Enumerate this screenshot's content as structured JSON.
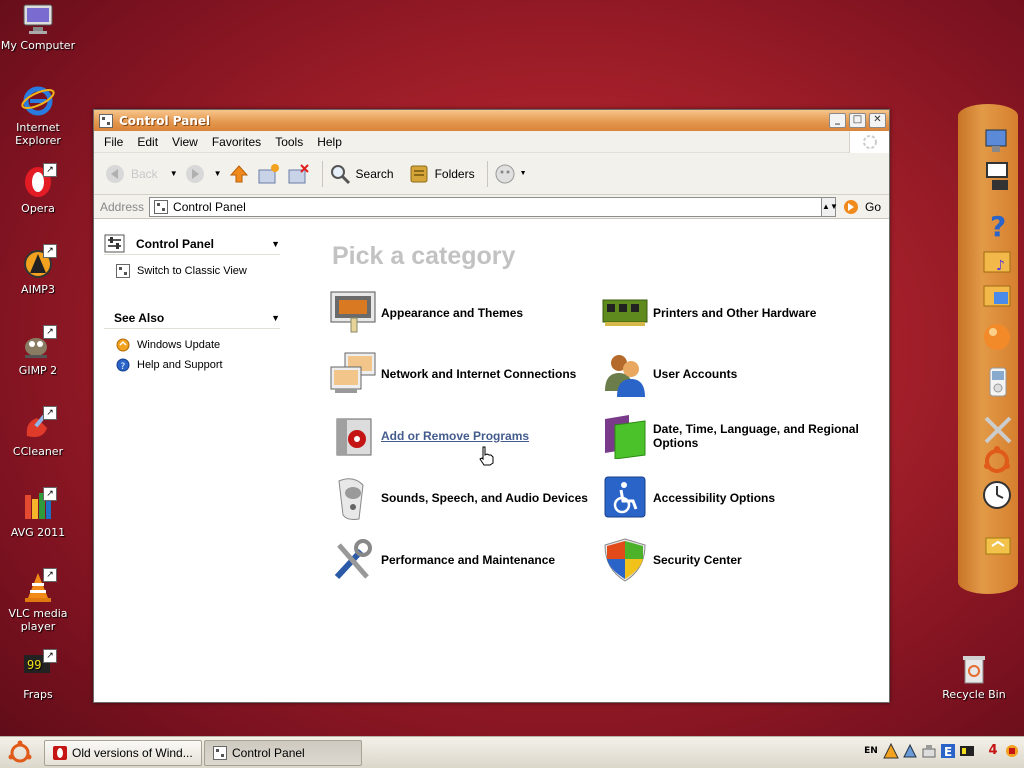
{
  "desktop": {
    "icons": [
      {
        "label": "My Computer"
      },
      {
        "label": "Internet Explorer"
      },
      {
        "label": "Opera"
      },
      {
        "label": "AIMP3"
      },
      {
        "label": "GIMP 2"
      },
      {
        "label": "CCleaner"
      },
      {
        "label": "AVG 2011"
      },
      {
        "label": "VLC media player"
      },
      {
        "label": "Fraps"
      },
      {
        "label": "Recycle Bin"
      }
    ]
  },
  "window": {
    "title": "Control Panel",
    "controls": {
      "minimize": "_",
      "maximize": "□",
      "close": "✕"
    }
  },
  "menubar": {
    "items": [
      "File",
      "Edit",
      "View",
      "Favorites",
      "Tools",
      "Help"
    ]
  },
  "toolbar": {
    "back_label": "Back",
    "search_label": "Search",
    "folders_label": "Folders"
  },
  "addressbar": {
    "label": "Address",
    "value": "Control Panel",
    "go_label": "Go"
  },
  "leftpanel": {
    "section1": {
      "title": "Control Panel",
      "links": [
        {
          "label": "Switch to Classic View"
        }
      ]
    },
    "section2": {
      "title": "See Also",
      "links": [
        {
          "label": "Windows Update"
        },
        {
          "label": "Help and Support"
        }
      ]
    }
  },
  "main": {
    "heading": "Pick a category",
    "categories": [
      {
        "label": "Appearance and Themes",
        "icon": "appearance-icon"
      },
      {
        "label": "Printers and Other Hardware",
        "icon": "printer-hardware-icon"
      },
      {
        "label": "Network and Internet Connections",
        "icon": "network-icon"
      },
      {
        "label": "User Accounts",
        "icon": "user-accounts-icon"
      },
      {
        "label": "Add or Remove Programs",
        "icon": "add-remove-programs-icon"
      },
      {
        "label": "Date, Time, Language, and Regional Options",
        "icon": "date-time-icon"
      },
      {
        "label": "Sounds, Speech, and Audio Devices",
        "icon": "speaker-icon"
      },
      {
        "label": "Accessibility Options",
        "icon": "accessibility-icon"
      },
      {
        "label": "Performance and Maintenance",
        "icon": "tools-icon"
      },
      {
        "label": "Security Center",
        "icon": "shield-icon"
      }
    ]
  },
  "taskbar": {
    "tasks": [
      {
        "label": "Old versions of Wind..."
      },
      {
        "label": "Control Panel"
      }
    ],
    "tray": {
      "language": "EN",
      "clock_hint": "4"
    }
  },
  "colors": {
    "desktop_bg": "#a5202a",
    "titlebar": "#e3964d",
    "link_hover": "#445c8d",
    "heading": "#c2c2c2",
    "dock": "#e29a47"
  }
}
